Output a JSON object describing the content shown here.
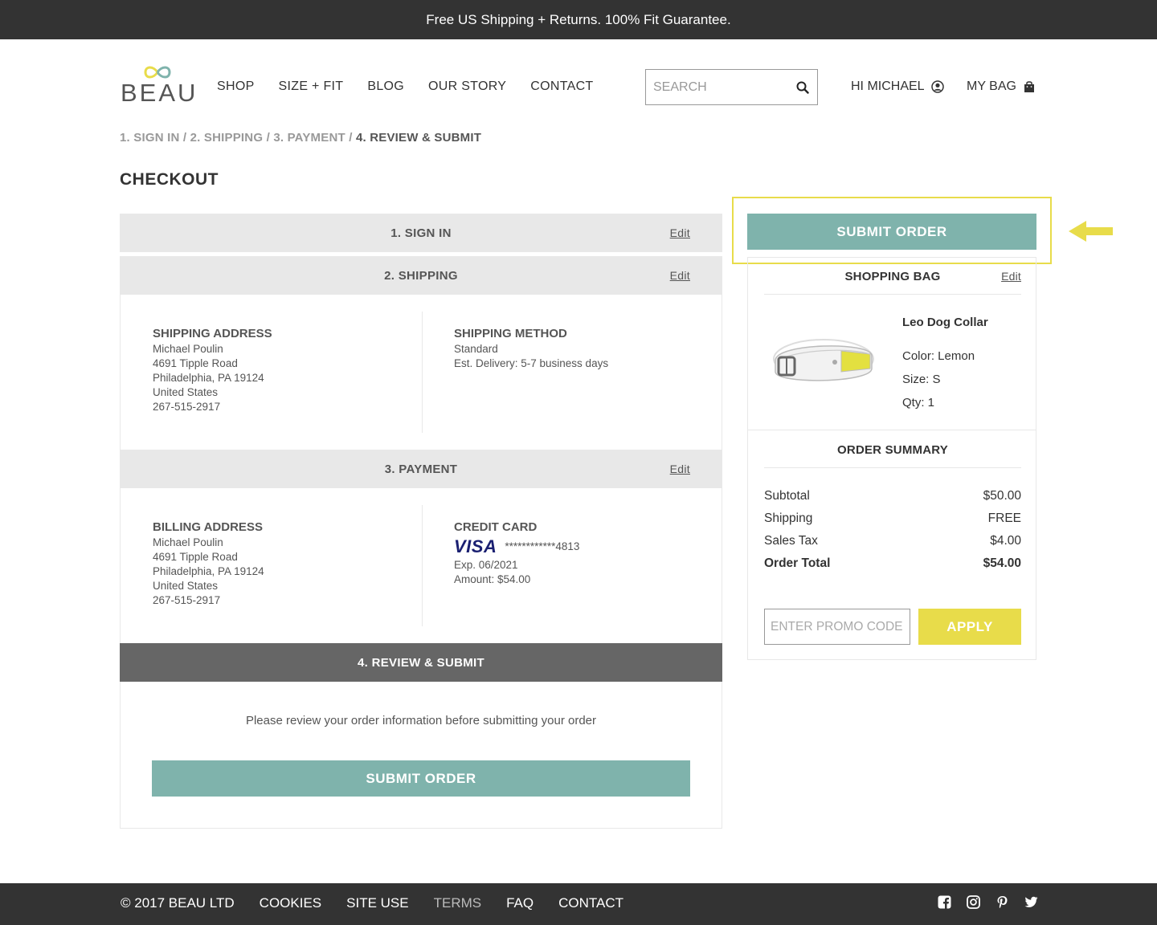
{
  "topbar": {
    "text": "Free US Shipping + Returns. 100% Fit Guarantee."
  },
  "header": {
    "logo": "BEAU",
    "nav": [
      "SHOP",
      "SIZE + FIT",
      "BLOG",
      "OUR STORY",
      "CONTACT"
    ],
    "search_placeholder": "SEARCH",
    "user_label": "HI MICHAEL",
    "bag_label": "MY BAG"
  },
  "breadcrumb": {
    "steps": [
      "1. SIGN IN",
      "2. SHIPPING",
      "3. PAYMENT"
    ],
    "sep": " / ",
    "current": "4. REVIEW & SUBMIT"
  },
  "page_title": "CHECKOUT",
  "sections": {
    "signin": {
      "title": "1. SIGN IN",
      "edit": "Edit"
    },
    "shipping": {
      "title": "2. SHIPPING",
      "edit": "Edit",
      "address_heading": "SHIPPING ADDRESS",
      "address_lines": [
        "Michael Poulin",
        "4691 Tipple Road",
        "Philadelphia, PA 19124",
        "United States",
        "267-515-2917"
      ],
      "method_heading": "SHIPPING METHOD",
      "method_lines": [
        "Standard",
        "Est. Delivery: 5-7 business days"
      ]
    },
    "payment": {
      "title": "3. PAYMENT",
      "edit": "Edit",
      "billing_heading": "BILLING ADDRESS",
      "billing_lines": [
        "Michael Poulin",
        "4691 Tipple Road",
        "Philadelphia, PA 19124",
        "United States",
        "267-515-2917"
      ],
      "card_heading": "CREDIT CARD",
      "card_brand": "VISA",
      "card_number": "************4813",
      "card_exp": "Exp. 06/2021",
      "card_amount": "Amount: $54.00"
    },
    "review": {
      "title": "4. REVIEW & SUBMIT",
      "message": "Please review your order information before submitting your order",
      "button": "SUBMIT ORDER"
    }
  },
  "sidebar": {
    "submit_button": "SUBMIT ORDER",
    "bag_heading": "SHOPPING BAG",
    "bag_edit": "Edit",
    "product": {
      "name": "Leo Dog Collar",
      "color": "Color: Lemon",
      "size": "Size: S",
      "qty": "Qty: 1"
    },
    "summary_heading": "ORDER SUMMARY",
    "summary_rows": [
      {
        "label": "Subtotal",
        "value": "$50.00"
      },
      {
        "label": "Shipping",
        "value": "FREE"
      },
      {
        "label": "Sales Tax",
        "value": "$4.00"
      },
      {
        "label": "Order Total",
        "value": "$54.00"
      }
    ],
    "promo_placeholder": "ENTER PROMO CODE",
    "apply_button": "APPLY"
  },
  "footer": {
    "copyright": "© 2017 BEAU LTD",
    "links": [
      "COOKIES",
      "SITE USE",
      "TERMS",
      "FAQ",
      "CONTACT"
    ],
    "social": [
      "facebook-icon",
      "instagram-icon",
      "pinterest-icon",
      "twitter-icon"
    ]
  },
  "colors": {
    "teal": "#7fb3ac",
    "yellow": "#e8dc4a",
    "dark": "#333333",
    "section_gray": "#e8e8e8",
    "review_header": "#666666"
  }
}
